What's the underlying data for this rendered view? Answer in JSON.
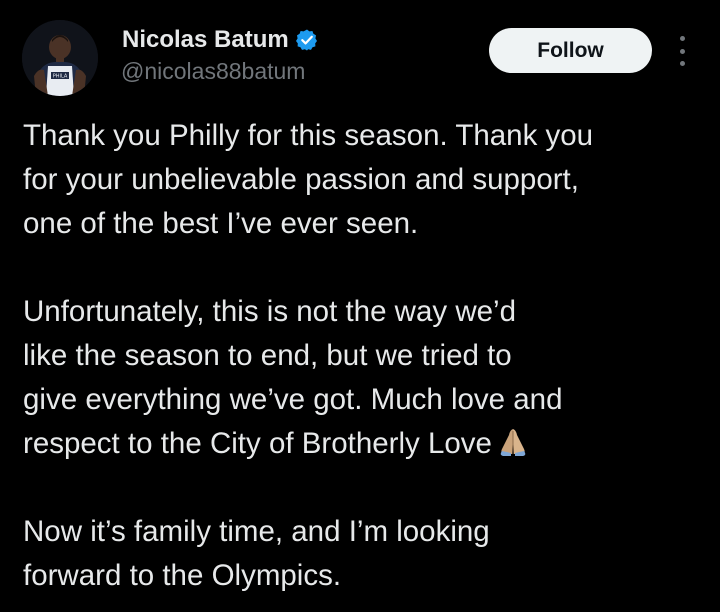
{
  "author": {
    "display_name": "Nicolas Batum",
    "handle": "@nicolas88batum",
    "verified": true,
    "avatar_jersey_text": "PHILA"
  },
  "actions": {
    "follow_label": "Follow",
    "more_icon": "more-vertical-icon"
  },
  "tweet": {
    "paragraph_1": [
      "Thank you Philly for this season. Thank you",
      "for your unbelievable passion and support,",
      "one of the best I’ve ever seen."
    ],
    "paragraph_2": [
      "Unfortunately, this is not the way we’d",
      "like the season to end, but we tried to",
      "give everything we’ve got. Much love and",
      "respect to the City of Brotherly Love"
    ],
    "paragraph_2_emoji": "folded-hands-icon",
    "paragraph_3": [
      "Now it’s family time, and I’m looking",
      "forward to the Olympics."
    ]
  },
  "colors": {
    "background": "#000000",
    "text": "#e7e9ea",
    "secondary_text": "#71767b",
    "verified_badge": "#1d9bf0",
    "follow_button_bg": "#eff3f4"
  }
}
